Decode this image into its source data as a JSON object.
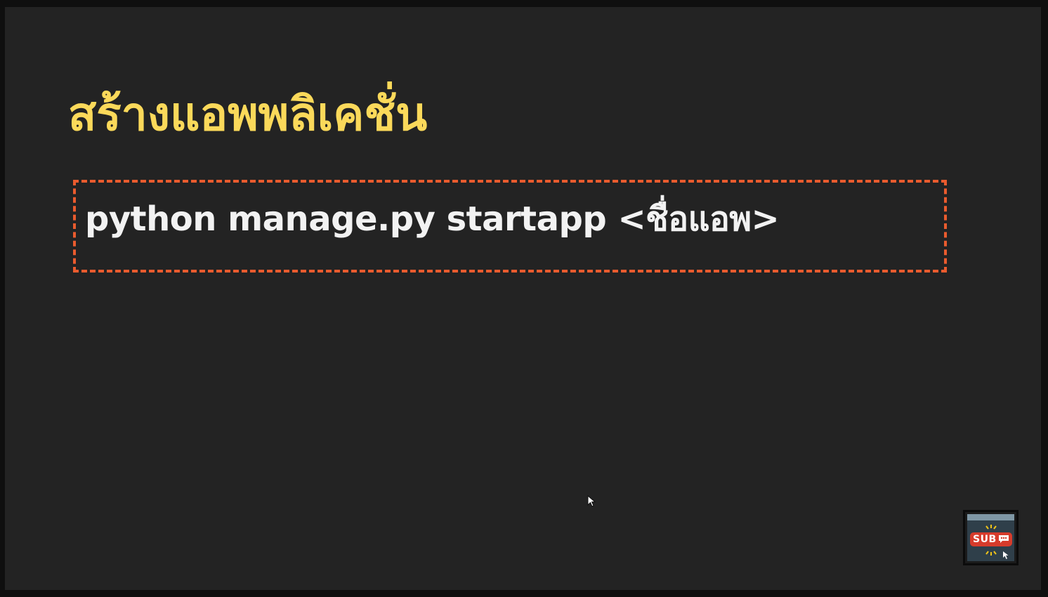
{
  "slide": {
    "title": "สร้างแอพพลิเคชั่น",
    "command": "python manage.py startapp <ชื่อแอพ>"
  },
  "colors": {
    "background": "#232323",
    "title": "#fbd95a",
    "box_border": "#ea5b2e",
    "command_text": "#f2f2f2",
    "badge_red": "#d63b2b"
  },
  "sub_badge": {
    "label": "SUB",
    "icon": "subscribe-badge-icon"
  }
}
